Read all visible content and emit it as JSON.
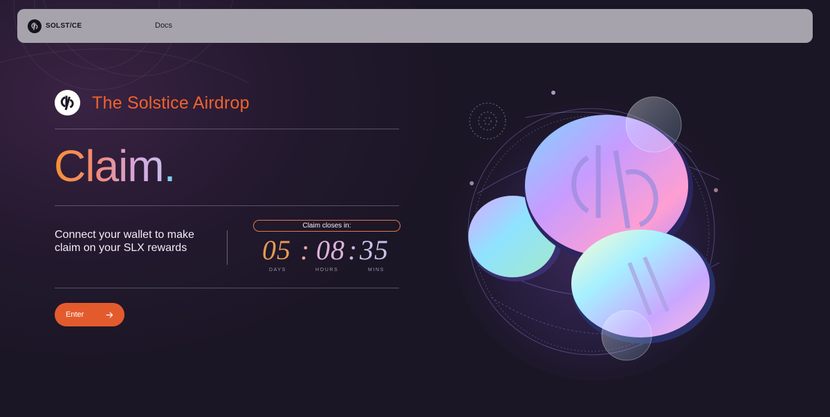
{
  "nav": {
    "brand": "SOLST/CE",
    "links": [
      "Docs"
    ]
  },
  "hero": {
    "title": "The Solstice Airdrop",
    "heading": "Claim",
    "heading_dot": ".",
    "description": "Connect your wallet to make claim on your SLX rewards"
  },
  "countdown": {
    "pill_label": "Claim closes in:",
    "days": "05",
    "hours": "08",
    "mins": "35",
    "separator": ":",
    "labels": [
      "DAYS",
      "HOURS",
      "MINS"
    ]
  },
  "cta": {
    "label": "Enter",
    "icon": "arrow-right-icon"
  },
  "colors": {
    "accent": "#e35b2d",
    "title": "#f0622d",
    "background": "#1b1626",
    "navbar": "#a7a3ac"
  },
  "icons": [
    "solstice-logo-icon",
    "arrow-right-icon",
    "coins-orb-illustration"
  ]
}
